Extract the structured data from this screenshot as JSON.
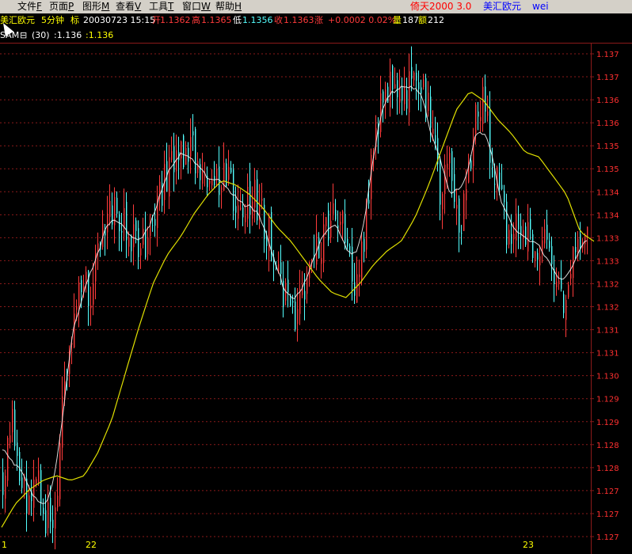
{
  "menu": {
    "items": [
      {
        "label": "文件",
        "key": "F"
      },
      {
        "label": "页面",
        "key": "P"
      },
      {
        "label": "图形",
        "key": "M"
      },
      {
        "label": "查看",
        "key": "V"
      },
      {
        "label": "工具",
        "key": "T"
      },
      {
        "label": "窗口",
        "key": "W"
      },
      {
        "label": "帮助",
        "key": "H"
      }
    ],
    "app_title": "倚天2000 3.0",
    "symbol_title": "美汇欧元",
    "user": "wei"
  },
  "quote": {
    "symbol": "美汇欧元",
    "period": "5分钟",
    "mode": "标",
    "datetime": "20030723 15:15",
    "open_label": "开",
    "open": "1.1362",
    "high_label": "高",
    "high": "1.1365",
    "low_label": "低",
    "low": "1.1356",
    "close_label": "收",
    "close": "1.1363",
    "change_label": "涨",
    "change": "+0.0002 0.02%",
    "volume_label": "量",
    "volume": "187",
    "amount_label": "额",
    "amount": "212"
  },
  "indicator": {
    "name": "SAM",
    "toggle": "⊟",
    "period": "(30)",
    "value1": ":1.136",
    "value2": ":1.136"
  },
  "colors": {
    "background": "#000000",
    "up": "#ff3b3b",
    "down": "#54ffff",
    "ma_line": "#e0e000",
    "price_line": "#ffffff",
    "grid": "#8b1a1a",
    "axis_text": "#ff3030",
    "date_text": "#ffff00",
    "menu_bg": "#d4d0c8",
    "title_red": "#ff0000",
    "title_blue": "#0000ff"
  },
  "chart_data": {
    "type": "candlestick",
    "y_ticks": [
      "1.137",
      "1.137",
      "1.136",
      "1.136",
      "1.135",
      "1.135",
      "1.134",
      "1.134",
      "1.133",
      "1.133",
      "1.132",
      "1.132",
      "1.131",
      "1.131",
      "1.130",
      "1.129",
      "1.129",
      "1.128",
      "1.128",
      "1.127",
      "1.127",
      "1.127"
    ],
    "ylim": [
      1.1268,
      1.1375
    ],
    "x_labels": [
      "1",
      "22",
      "23"
    ],
    "price_path": [
      1.1283,
      1.1298,
      1.1285,
      1.1277,
      1.1281,
      1.1274,
      1.1272,
      1.1303,
      1.1311,
      1.1325,
      1.1322,
      1.133,
      1.1335,
      1.134,
      1.1338,
      1.1333,
      1.133,
      1.1336,
      1.134,
      1.1347,
      1.1352,
      1.1349,
      1.1353,
      1.1348,
      1.1346,
      1.1344,
      1.1346,
      1.1342,
      1.1338,
      1.1343,
      1.134,
      1.1334,
      1.1325,
      1.1319,
      1.1318,
      1.1323,
      1.1329,
      1.1333,
      1.1336,
      1.134,
      1.1331,
      1.1323,
      1.1335,
      1.135,
      1.1361,
      1.1368,
      1.1363,
      1.1365,
      1.1369,
      1.1364,
      1.1357,
      1.1342,
      1.1351,
      1.1336,
      1.1343,
      1.136,
      1.1362,
      1.135,
      1.1344,
      1.1331,
      1.1339,
      1.1334,
      1.1326,
      1.1335,
      1.1326,
      1.132,
      1.1326,
      1.1331,
      1.1336
    ],
    "ma_path": [
      1.1272,
      1.1277,
      1.128,
      1.1282,
      1.1283,
      1.1282,
      1.1283,
      1.1288,
      1.1295,
      1.1305,
      1.1315,
      1.1324,
      1.133,
      1.1334,
      1.1339,
      1.1343,
      1.1346,
      1.1345,
      1.1343,
      1.134,
      1.1336,
      1.1333,
      1.1329,
      1.1325,
      1.1322,
      1.1321,
      1.1324,
      1.1328,
      1.1331,
      1.1333,
      1.1338,
      1.1345,
      1.1353,
      1.1361,
      1.1365,
      1.1363,
      1.1359,
      1.1356,
      1.1352,
      1.1351,
      1.1347,
      1.1343,
      1.1335,
      1.1333
    ]
  }
}
